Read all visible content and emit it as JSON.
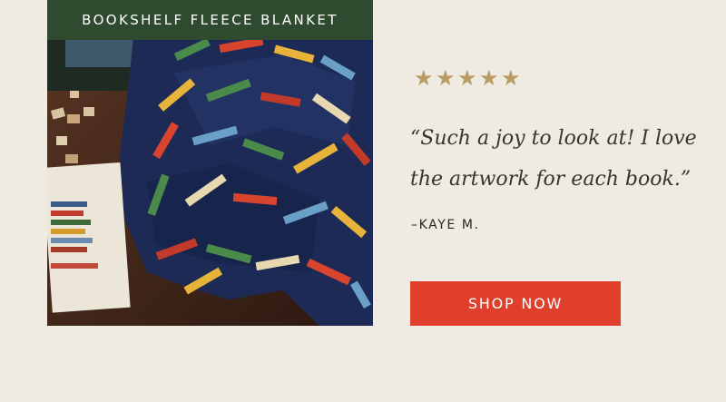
{
  "product": {
    "banner_title": "BOOKSHELF FLEECE BLANKET",
    "image_alt": "Bookshelf fleece blanket draped on a wooden table next to a book and puzzle pieces"
  },
  "review": {
    "rating": 5,
    "rating_max": 5,
    "star_glyph": "★",
    "star_color": "#b79d63",
    "quote": "“Such a joy to look at! I love the artwork for each book.”",
    "author": "–KAYE M."
  },
  "cta": {
    "label": "SHOP NOW",
    "color": "#e0402b"
  },
  "theme": {
    "background": "#efebe2",
    "banner_color": "#2e4a2f"
  }
}
